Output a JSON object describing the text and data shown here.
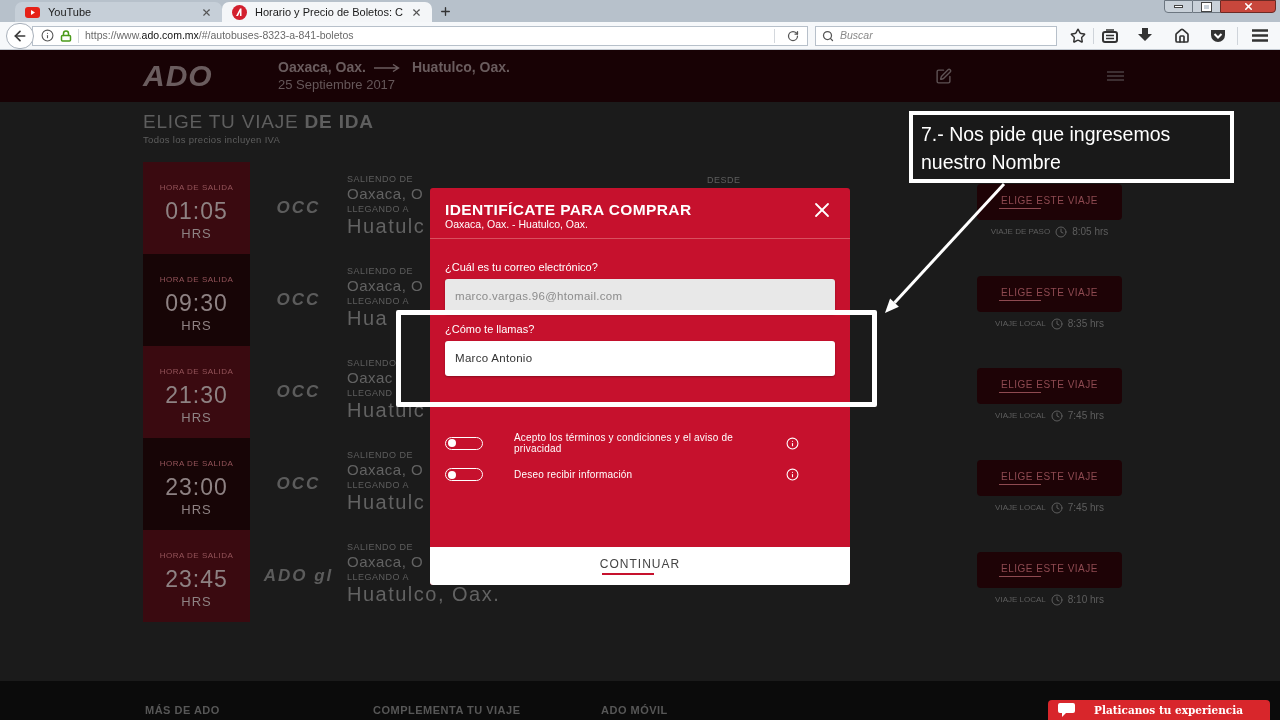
{
  "browser": {
    "tabs": [
      {
        "title": "YouTube",
        "selected": false
      },
      {
        "title": "Horario y Precio de Boletos: C",
        "selected": true
      }
    ],
    "url": {
      "prefix": "https://www.",
      "domain": "ado.com.mx",
      "path": "/#/autobuses-8323-a-841-boletos"
    },
    "search": {
      "placeholder": "Buscar"
    }
  },
  "header": {
    "logo": "ADO",
    "origin": "Oaxaca, Oax.",
    "destination": "Huatulco, Oax.",
    "date": "25 Septiembre 2017"
  },
  "results": {
    "title": "ELIGE TU VIAJE **DE IDA**",
    "subtitle": "Todos los precios incluyen IVA",
    "trips": [
      {
        "departure_label": "HORA DE SALIDA",
        "time": "01:05",
        "unit": "HRS",
        "carrier": "OCC",
        "from_label": "SALIENDO DE",
        "from": "Oaxaca, O",
        "to_label": "LLEGANDO A",
        "to": "Huatulc",
        "price_label": "DESDE",
        "button": "ELIGE ESTE VIAJE",
        "trip_type": "VIAJE DE PASO",
        "duration": "8:05 hrs"
      },
      {
        "departure_label": "HORA DE SALIDA",
        "time": "09:30",
        "unit": "HRS",
        "carrier": "OCC",
        "from_label": "SALIENDO DE",
        "from": "Oaxaca, O",
        "to_label": "LLEGANDO A",
        "to": "Hua",
        "button": "ELIGE ESTE VIAJE",
        "trip_type": "VIAJE LOCAL",
        "duration": "8:35 hrs"
      },
      {
        "departure_label": "HORA DE SALIDA",
        "time": "21:30",
        "unit": "HRS",
        "carrier": "OCC",
        "from_label": "SALIENDO",
        "from": "Oaxac",
        "to_label": "LLEGAND",
        "to": "Huatulc",
        "button": "ELIGE ESTE VIAJE",
        "trip_type": "VIAJE LOCAL",
        "duration": "7:45 hrs"
      },
      {
        "departure_label": "HORA DE SALIDA",
        "time": "23:00",
        "unit": "HRS",
        "carrier": "OCC",
        "from_label": "SALIENDO DE",
        "from": "Oaxaca, O",
        "to_label": "LLEGANDO A",
        "to": "Huatulc",
        "button": "ELIGE ESTE VIAJE",
        "trip_type": "VIAJE LOCAL",
        "duration": "7:45 hrs"
      },
      {
        "departure_label": "HORA DE SALIDA",
        "time": "23:45",
        "unit": "HRS",
        "carrier": "ADO gl",
        "from_label": "SALIENDO DE",
        "from": "Oaxaca, O",
        "to_label": "LLEGANDO A",
        "to": "Huatulco, Oax.",
        "button": "ELIGE ESTE VIAJE",
        "trip_type": "VIAJE LOCAL",
        "duration": "8:10 hrs"
      }
    ]
  },
  "modal": {
    "title": "IDENTIFÍCATE PARA COMPRAR",
    "route": "Oaxaca, Oax. - Huatulco, Oax.",
    "fields": [
      {
        "label": "¿Cuál es tu correo electrónico?",
        "value": "marco.vargas.96@htomail.com",
        "disabled": true
      },
      {
        "label": "¿Cómo te llamas?",
        "value": "Marco Antonio",
        "disabled": false
      }
    ],
    "toggles": [
      {
        "label": "Acepto los términos y condiciones y el aviso de privacidad",
        "on": false
      },
      {
        "label": "Deseo recibir información",
        "on": false
      }
    ],
    "button": "CONTINUAR"
  },
  "annotation": {
    "text": "7.- Nos pide que ingresemos nuestro Nombre"
  },
  "footer": {
    "headings": [
      "MÁS DE ADO",
      "COMPLEMENTA TU VIAJE",
      "ADO MÓVIL"
    ]
  },
  "chat_widget": {
    "label": "Platicanos tu experiencia"
  }
}
